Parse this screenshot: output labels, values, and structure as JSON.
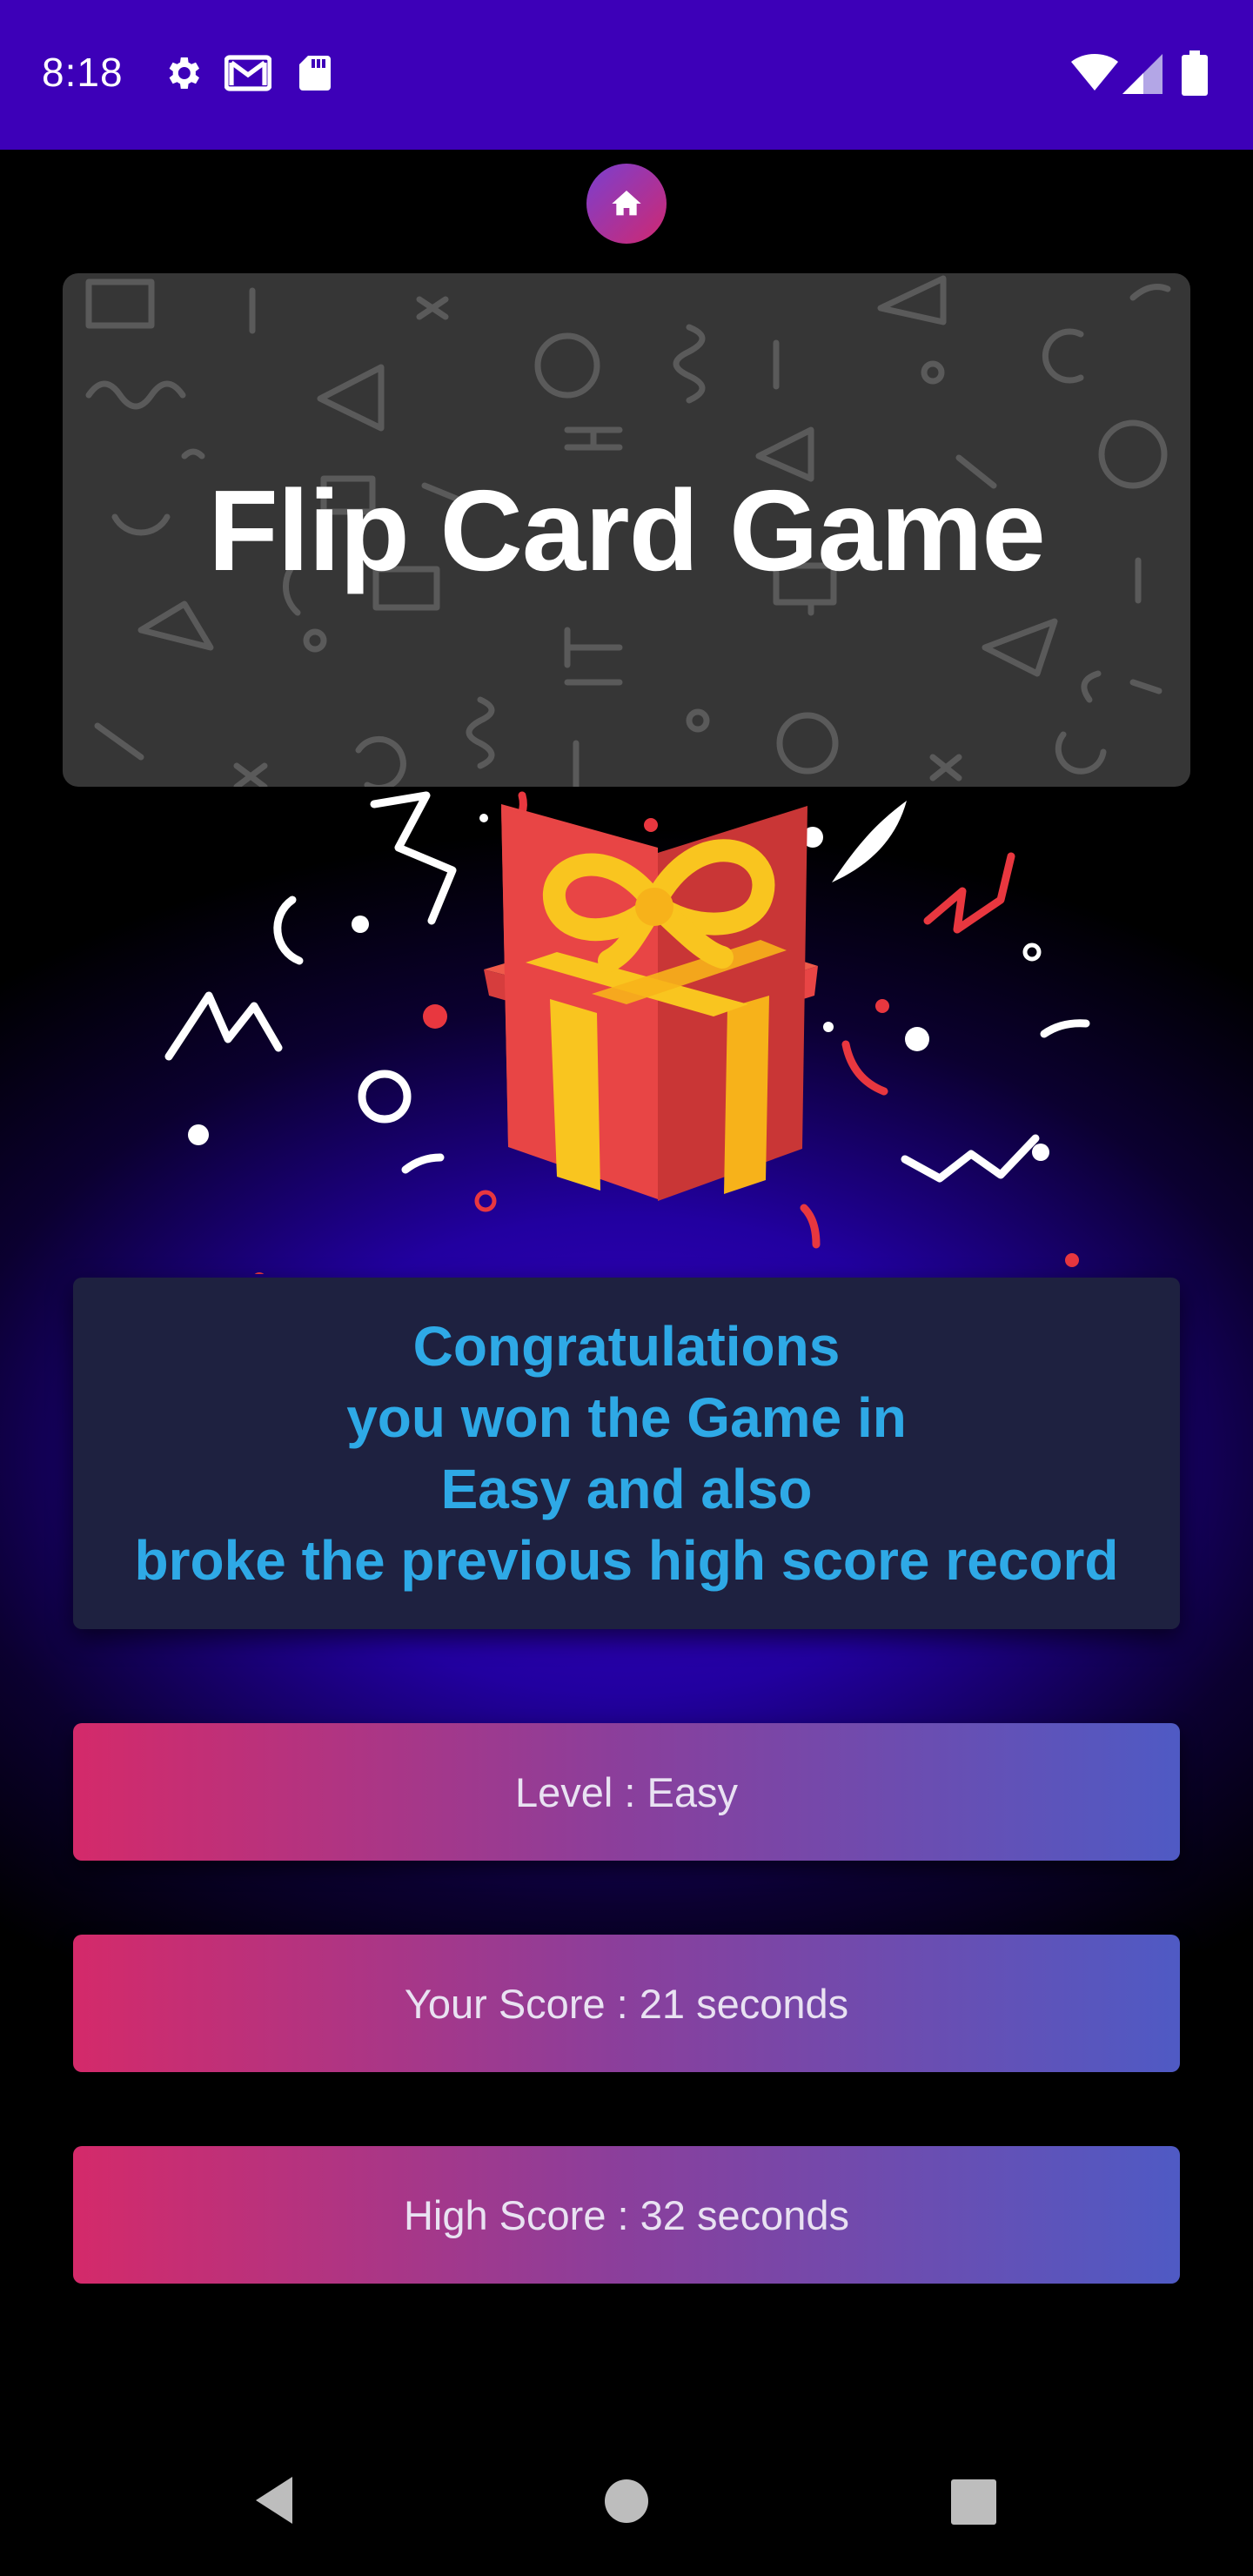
{
  "status_bar": {
    "time": "8:18",
    "icons": [
      "gear-icon",
      "gmail-icon",
      "sd-card-icon",
      "wifi-icon",
      "signal-icon",
      "battery-icon"
    ]
  },
  "header": {
    "home_icon": "home-icon"
  },
  "banner": {
    "title": "Flip Card Game"
  },
  "illustration": {
    "icon": "gift-icon",
    "colors": {
      "box": "#e84545",
      "ribbon": "#f9c51f"
    }
  },
  "message": {
    "lines": [
      "Congratulations",
      "you won the Game in",
      "Easy and also",
      "broke the previous high score record"
    ]
  },
  "stats": {
    "level": "Level : Easy",
    "your_score": "Your Score : 21 seconds",
    "high_score": "High Score : 32 seconds"
  },
  "nav": {
    "back": "back-icon",
    "home": "home-circle-icon",
    "recents": "recents-icon"
  },
  "colors": {
    "status_bar": "#3d00b8",
    "message_text": "#2ea9e6",
    "bar_gradient_start": "#d42a6a",
    "bar_gradient_end": "#4f5ac4"
  }
}
